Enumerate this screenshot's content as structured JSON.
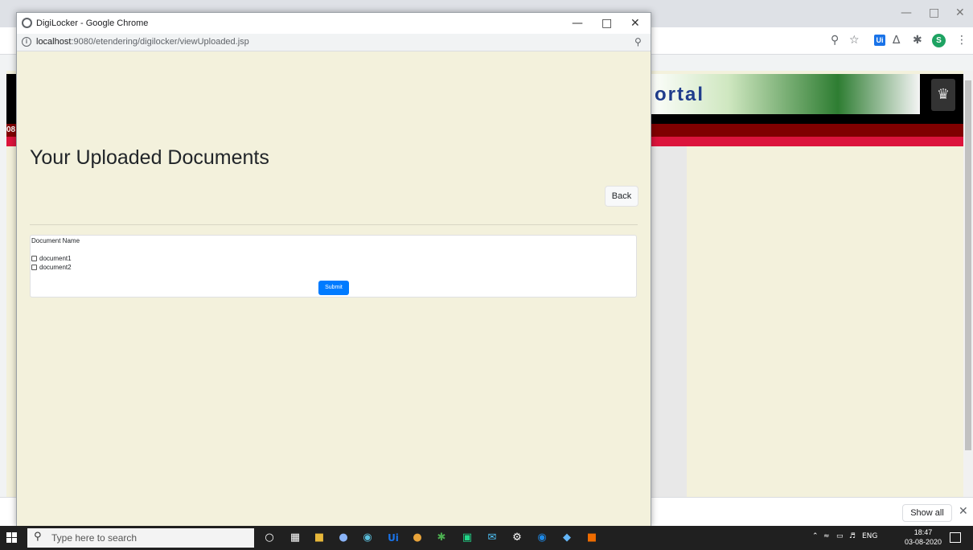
{
  "popup": {
    "window_title": "DigiLocker - Google Chrome",
    "url_host": "localhost",
    "url_rest": ":9080/etendering/digilocker/viewUploaded.jsp",
    "heading": "Your Uploaded Documents",
    "back_label": "Back",
    "doc_label": "Document Name",
    "documents": [
      "document1",
      "document2"
    ],
    "submit_label": "Submit"
  },
  "background": {
    "banner_text": "ortal",
    "redbar_text": "08",
    "show_all_label": "Show all"
  },
  "taskbar": {
    "search_placeholder": "Type here to search",
    "tray_lang": "ENG",
    "time": "18:47",
    "date": "03-08-2020"
  },
  "colors": {
    "page_bg": "#f3f1dc",
    "submit_blue": "#007bff",
    "banner_red": "#800000",
    "accent_crimson": "#dc143c"
  }
}
